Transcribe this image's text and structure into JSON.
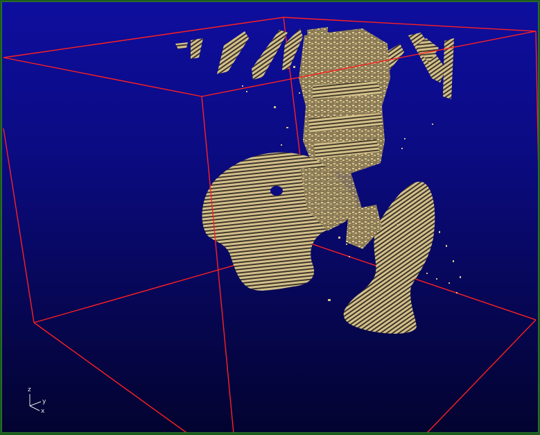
{
  "viewer": {
    "background_top": "#0e0e9e",
    "background_bottom": "#030330",
    "frame_color": "#1d5a1d",
    "bounding_box_color": "#ff2020",
    "surface_color": "#d4c08a",
    "surface_shadow_color": "#4a3f24"
  },
  "orientation_axes": {
    "z_label": "z",
    "y_label": "y",
    "x_label": "x",
    "axis_color": "#e8e8e8"
  }
}
